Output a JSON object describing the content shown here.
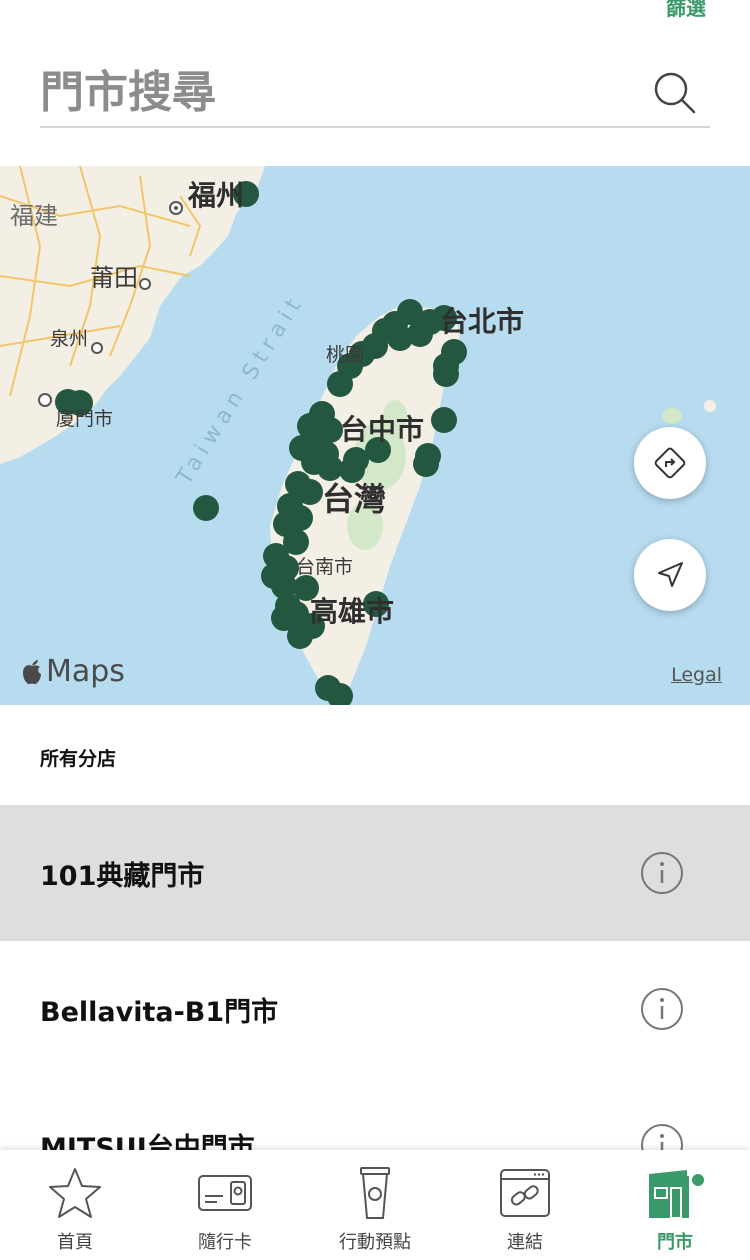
{
  "header": {
    "filter_label": "篩選",
    "search_placeholder": "門市搜尋"
  },
  "map": {
    "labels": {
      "fuzhou": "福州",
      "fujian": "福建",
      "putian": "莆田",
      "quanzhou": "泉州",
      "xiamen": "廈門市",
      "strait": "Taiwan Strait",
      "taoyuan": "桃園",
      "taipei": "台北市",
      "taichung": "台中市",
      "taiwan": "台灣",
      "tainan": "台南市",
      "kaohsiung": "高雄市"
    },
    "attribution": "Maps",
    "legal": "Legal",
    "marker_color": "#24573f"
  },
  "section_title": "所有分店",
  "stores": [
    {
      "name": "101典藏門市",
      "selected": true
    },
    {
      "name": "Bellavita-B1門市",
      "selected": false
    },
    {
      "name": "MITSUI台中門市",
      "selected": false
    }
  ],
  "tabs": [
    {
      "label": "首頁",
      "icon": "star-icon"
    },
    {
      "label": "隨行卡",
      "icon": "card-icon"
    },
    {
      "label": "行動預點",
      "icon": "cup-icon"
    },
    {
      "label": "連結",
      "icon": "link-icon"
    },
    {
      "label": "門市",
      "icon": "store-icon",
      "active": true
    }
  ],
  "colors": {
    "accent": "#3a9a69",
    "marker": "#24573f",
    "water": "#b7dcf0",
    "selected_row": "#dedede"
  }
}
